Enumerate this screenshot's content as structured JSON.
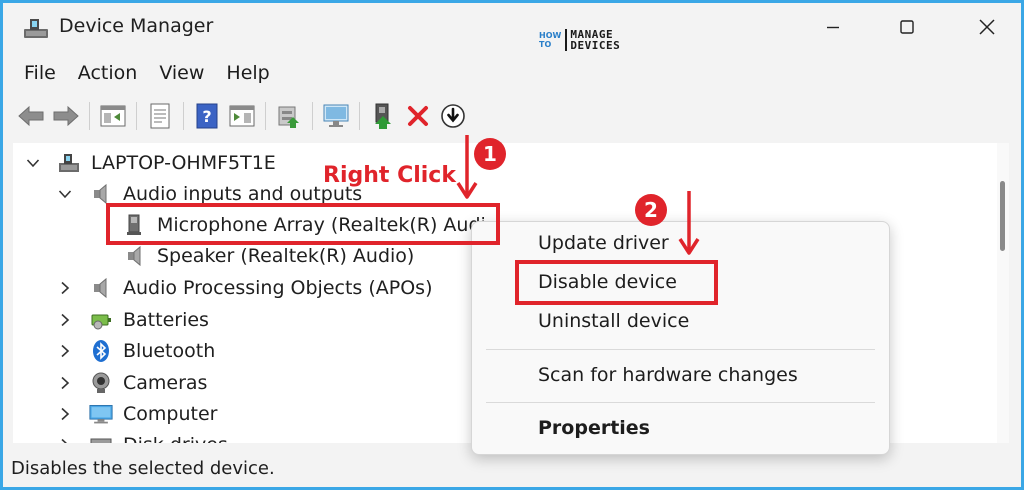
{
  "window": {
    "title": "Device Manager",
    "icons": {
      "app": "device-manager-icon",
      "minimize": "minimize-icon",
      "maximize": "maximize-icon",
      "close": "close-icon"
    }
  },
  "logo": {
    "line1": "HOW",
    "line2": "TO",
    "brand1": "MANAGE",
    "brand2": "DEVICES"
  },
  "menu": [
    "File",
    "Action",
    "View",
    "Help"
  ],
  "toolbar": {
    "icons": [
      "back-arrow-icon",
      "forward-arrow-icon",
      "show-hide-console-tree-icon",
      "properties-icon",
      "help-icon",
      "action-pane-icon",
      "update-driver-icon",
      "scan-hardware-icon",
      "enable-device-icon",
      "uninstall-device-icon",
      "disable-device-icon"
    ]
  },
  "tree": {
    "root": "LAPTOP-OHMF5T1E",
    "audio_category": "Audio inputs and outputs",
    "audio_children": [
      "Microphone Array (Realtek(R) Audi",
      "Speaker (Realtek(R) Audio)"
    ],
    "categories": [
      "Audio Processing Objects (APOs)",
      "Batteries",
      "Bluetooth",
      "Cameras",
      "Computer",
      "Disk drives"
    ]
  },
  "context_menu": {
    "items": [
      "Update driver",
      "Disable device",
      "Uninstall device",
      "Scan for hardware changes",
      "Properties"
    ]
  },
  "status_bar": {
    "text": "Disables the selected device."
  },
  "annotations": {
    "right_click_label": "Right Click",
    "step1": "1",
    "step2": "2",
    "accent_color": "#e0242b"
  },
  "colors": {
    "window_border": "#3aa7e6",
    "chrome": "#f3f3f3",
    "pane": "#ffffff"
  }
}
